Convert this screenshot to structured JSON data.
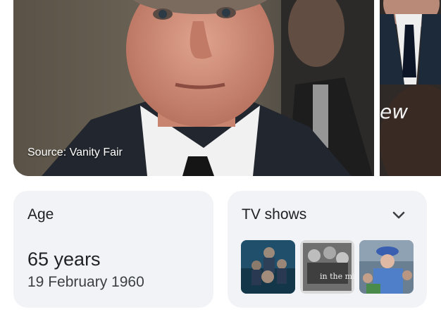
{
  "main_image": {
    "caption": "Source: Vanity Fair"
  },
  "side_image": {
    "overlay_text": "ew"
  },
  "age_card": {
    "title": "Age",
    "value": "65 years",
    "date": "19 February 1960"
  },
  "tv_card": {
    "title": "TV shows",
    "thumbnails": [
      {
        "icon": "tv-show-thumbnail",
        "overlay_text": ""
      },
      {
        "icon": "tv-show-thumbnail",
        "overlay_text": "in the mix"
      },
      {
        "icon": "tv-show-thumbnail",
        "overlay_text": ""
      }
    ]
  },
  "colors": {
    "card_bg": "#f1f3f6",
    "text_primary": "#202124",
    "text_secondary": "#3c4043"
  }
}
